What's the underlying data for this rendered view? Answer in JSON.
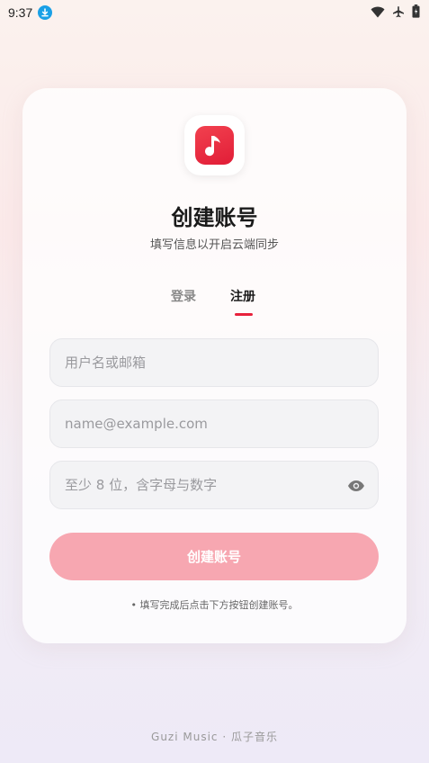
{
  "status_bar": {
    "time": "9:37"
  },
  "logo": {
    "icon": "music-note-icon",
    "color": "#e8213c"
  },
  "header": {
    "title": "创建账号",
    "subtitle": "填写信息以开启云端同步"
  },
  "tabs": [
    {
      "label": "登录",
      "active": false
    },
    {
      "label": "注册",
      "active": true
    }
  ],
  "form": {
    "username_placeholder": "用户名或邮箱",
    "email_placeholder": "name@example.com",
    "password_placeholder": "至少 8 位，含字母与数字",
    "submit_label": "创建账号",
    "hint": "•  填写完成后点击下方按钮创建账号。"
  },
  "footer": {
    "text": "Guzi Music · 瓜子音乐"
  },
  "colors": {
    "accent": "#e8213c",
    "button_disabled": "#f7a7b1"
  }
}
